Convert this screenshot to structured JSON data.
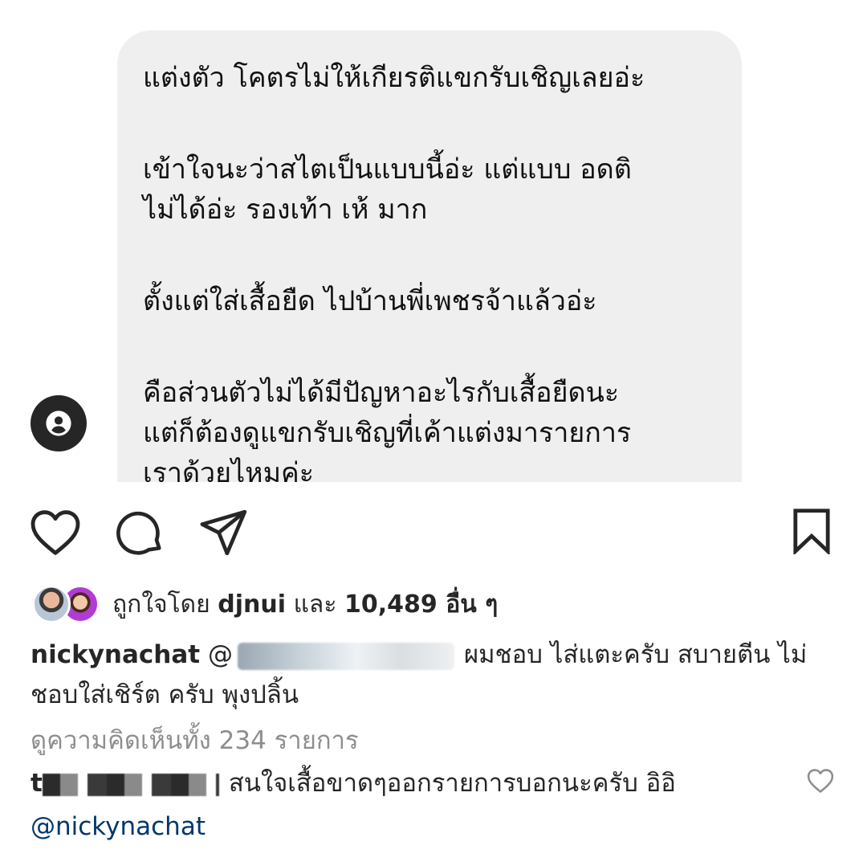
{
  "post": {
    "messages": [
      "แต่งตัว โคตรไม่ให้เกียรติแขกรับเชิญเลยอ่ะ",
      "เข้าใจนะว่าสไตเป็นแบบนี้อ่ะ แต่แบบ อดติ\nไม่ได้อ่ะ รองเท้า เห้ มาก",
      "ตั้งแต่ใส่เสื้อยืด ไปบ้านพี่เพชรจ้าแล้วอ่ะ",
      "คือส่วนตัวไม่ได้มีปัญหาอะไรกับเสื้อยืดนะ\nแต่ก็ต้องดูแขกรับเชิญที่เค้าแต่งมารายการ\nเราด้วยไหมค่ะ"
    ]
  },
  "icons": {
    "tag": "user-tag-icon",
    "like": "heart-icon",
    "comment": "comment-bubble-icon",
    "share": "paper-plane-icon",
    "save": "bookmark-icon",
    "comment_like": "heart-icon"
  },
  "likes": {
    "prefix": "ถูกใจโดย",
    "user": "djnui",
    "conjunction": "และ",
    "count": "10,489 อื่น ๆ"
  },
  "caption": {
    "username": "nickynachat",
    "mention_prefix": "@",
    "text": "ผมชอบ ไส่แตะครับ สบายตีน ไม่ชอบใส่เชิร์ต ครับ พุงปลิ้น"
  },
  "view_comments": "ดูความคิดเห็นทั้ง 234 รายการ",
  "comment": {
    "username_prefix": "t",
    "text": "สนใจเสื้อขาดๆออกรายการบอกนะครับ อิอิ",
    "mention": "@nickynachat"
  },
  "colors": {
    "bubble": "#efefef",
    "text": "#262626",
    "muted": "#8e8e8e",
    "mention": "#00376b"
  }
}
